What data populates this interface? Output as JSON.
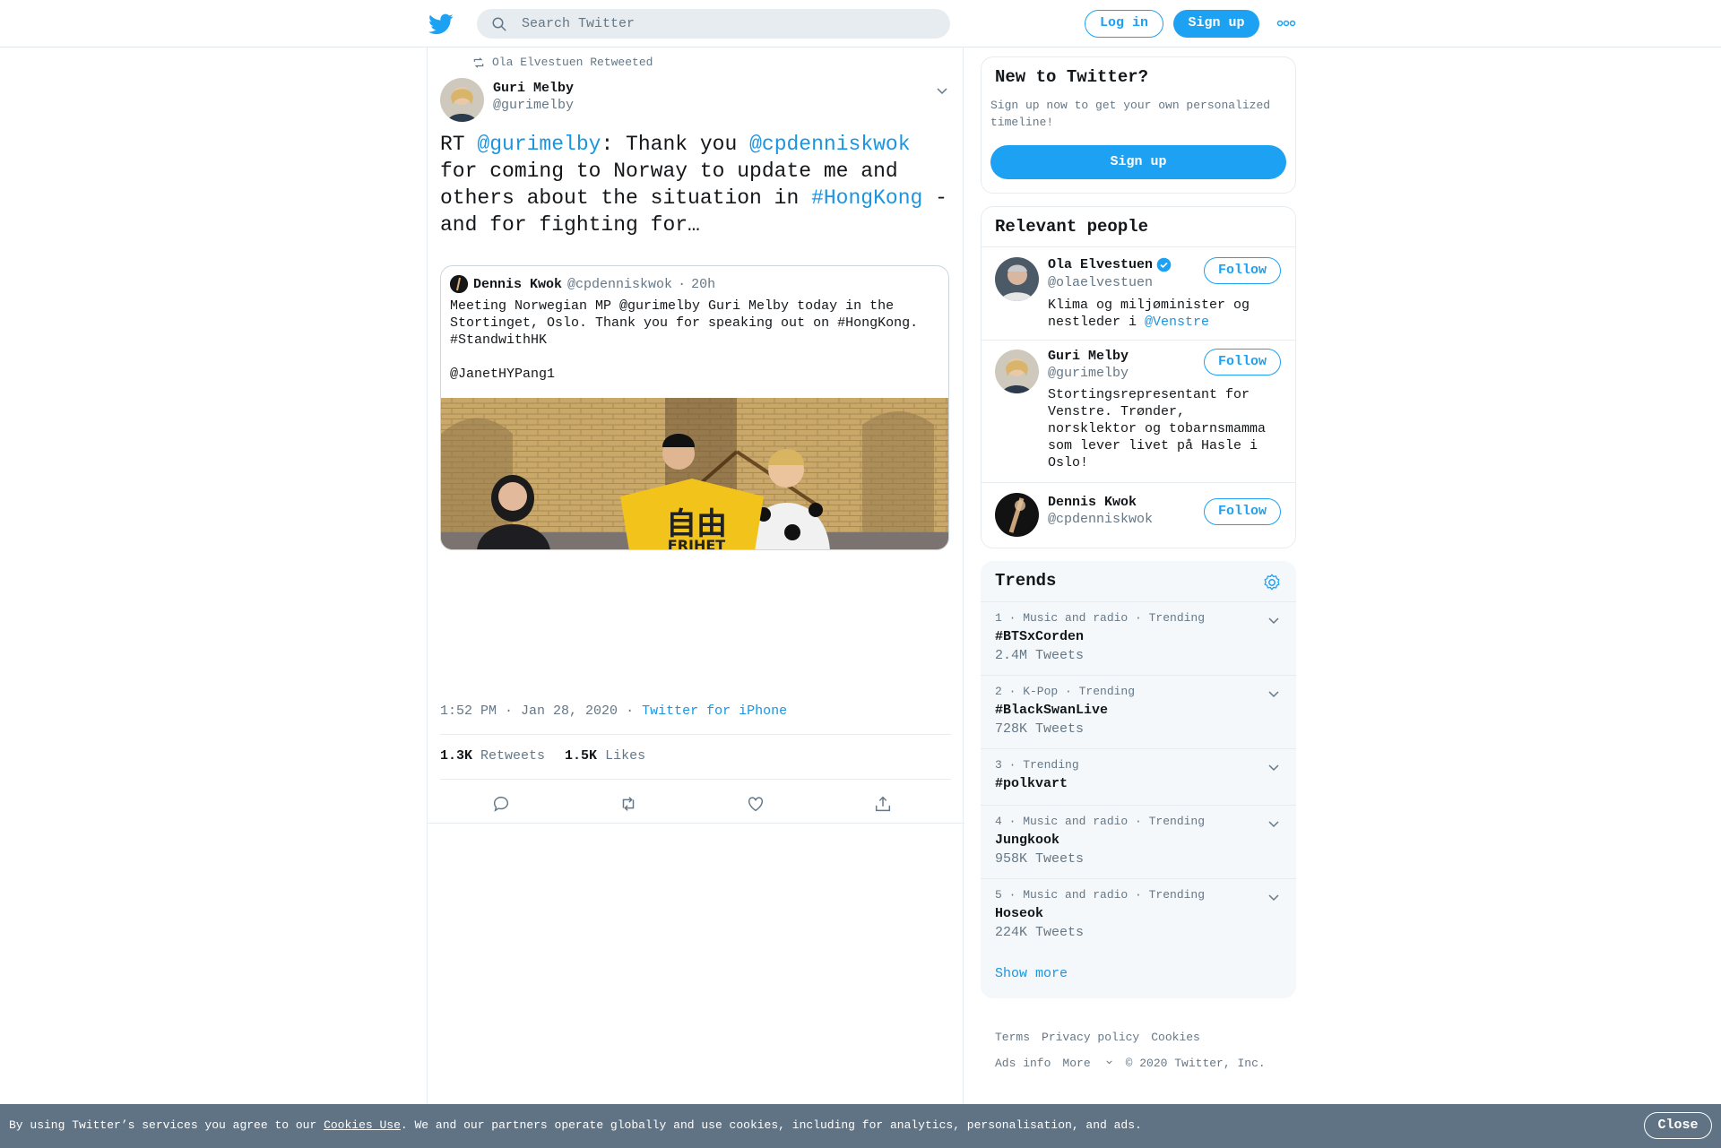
{
  "header": {
    "search_placeholder": "Search Twitter",
    "login_label": "Log in",
    "signup_label": "Sign up",
    "accent": "#1da1f2"
  },
  "tweet": {
    "retweeted_by": "Ola Elvestuen Retweeted",
    "author_name": "Guri Melby",
    "author_handle": "@gurimelby",
    "text_parts": {
      "p1": "RT ",
      "m1": "@gurimelby",
      "p2": ": Thank you ",
      "m2": "@cpdenniskwok",
      "p3": " for coming to Norway to update me and others about the situation in ",
      "h1": "#HongKong",
      "p4": " - and for fighting for…"
    },
    "quote": {
      "name": "Dennis Kwok",
      "handle": "@cpdenniskwok",
      "sep": "·",
      "age": "20h",
      "text": "Meeting Norwegian MP @gurimelby Guri Melby today in the Stortinget, Oslo. Thank you for speaking out on #HongKong. #StandwithHK\n\n@JanetHYPang1",
      "shirt_text": "FRIHET",
      "shirt_chars": "自由"
    },
    "time": "1:52 PM · Jan 28, 2020",
    "time_sep": "·",
    "source": "Twitter for iPhone",
    "retweets_count": "1.3K",
    "retweets_label": "Retweets",
    "likes_count": "1.5K",
    "likes_label": "Likes"
  },
  "new_to_twitter": {
    "title": "New to Twitter?",
    "text": "Sign up now to get your own personalized timeline!",
    "signup_label": "Sign up"
  },
  "relevant_people": {
    "title": "Relevant people",
    "people": [
      {
        "name": "Ola Elvestuen",
        "handle": "@olaelvestuen",
        "bio": "Klima og miljøminister og nestleder i ",
        "bio_link": "@Venstre",
        "follow": "Follow"
      },
      {
        "name": "Guri Melby",
        "handle": "@gurimelby",
        "bio": "Stortingsrepresentant for Venstre. Trønder, norsklektor og tobarnsmamma som lever livet på Hasle i Oslo!",
        "follow": "Follow"
      },
      {
        "name": "Dennis Kwok",
        "handle": "@cpdenniskwok",
        "follow": "Follow"
      }
    ]
  },
  "trends": {
    "title": "Trends",
    "items": [
      {
        "meta": "1 · Music and radio · Trending",
        "name": "#BTSxCorden",
        "count": "2.4M Tweets"
      },
      {
        "meta": "2 · K-Pop · Trending",
        "name": "#BlackSwanLive",
        "count": "728K Tweets"
      },
      {
        "meta": "3 · Trending",
        "name": "#polkvart",
        "count": ""
      },
      {
        "meta": "4 · Music and radio · Trending",
        "name": "Jungkook",
        "count": "958K Tweets"
      },
      {
        "meta": "5 · Music and radio · Trending",
        "name": "Hoseok",
        "count": "224K Tweets"
      }
    ],
    "show_more": "Show more"
  },
  "footer": {
    "terms": "Terms",
    "privacy": "Privacy policy",
    "cookies": "Cookies",
    "ads_info": "Ads info",
    "more": "More",
    "copyright": "© 2020 Twitter, Inc."
  },
  "cookie_bar": {
    "text_before": "By using Twitter’s services you agree to our ",
    "link": "Cookies Use",
    "text_after": ". We and our partners operate globally and use cookies, including for analytics, personalisation, and ads.",
    "close_label": "Close"
  }
}
